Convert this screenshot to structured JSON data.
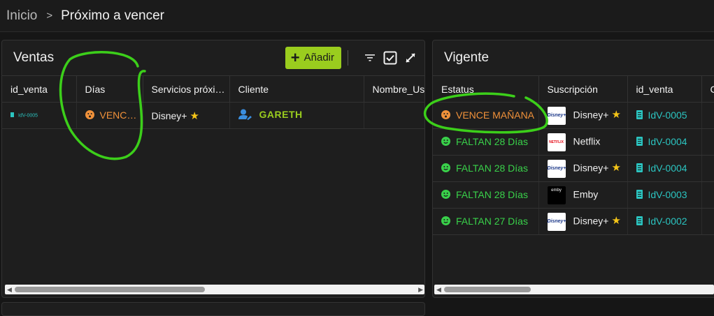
{
  "breadcrumb": {
    "home": "Inicio",
    "separator": ">",
    "current": "Próximo a vencer"
  },
  "ventas": {
    "title": "Ventas",
    "add_label": "Añadir",
    "columns": [
      "id_venta",
      "Días",
      "Servicios próxim...",
      "Cliente",
      "Nombre_Usu"
    ],
    "rows": [
      {
        "id_venta": "IdV-0005",
        "dias": "VENCE ...",
        "servicio": "Disney+",
        "cliente": "GARETH",
        "nombre": ""
      }
    ]
  },
  "vigente": {
    "title": "Vigente",
    "columns": [
      "Estatus",
      "Suscripción",
      "id_venta",
      "C"
    ],
    "rows": [
      {
        "estatus": "VENCE MAÑANA",
        "status_color": "#f0913a",
        "logo": "disney-logo",
        "logo_text": "Disney+",
        "suscripcion": "Disney+",
        "star": true,
        "id_venta": "IdV-0005"
      },
      {
        "estatus": "FALTAN 28 Días",
        "status_color": "#39d14a",
        "logo": "netflix-logo",
        "logo_text": "NETFLIX",
        "suscripcion": "Netflix",
        "star": false,
        "id_venta": "IdV-0004"
      },
      {
        "estatus": "FALTAN 28 Días",
        "status_color": "#39d14a",
        "logo": "disney-logo",
        "logo_text": "Disney+",
        "suscripcion": "Disney+",
        "star": true,
        "id_venta": "IdV-0004"
      },
      {
        "estatus": "FALTAN 28 Días",
        "status_color": "#39d14a",
        "logo": "emby-logo",
        "logo_text": "emby",
        "suscripcion": "Emby",
        "star": false,
        "id_venta": "IdV-0003"
      },
      {
        "estatus": "FALTAN 27 Días",
        "status_color": "#39d14a",
        "logo": "disney-logo",
        "logo_text": "Disney+",
        "suscripcion": "Disney+",
        "star": true,
        "id_venta": "IdV-0002"
      }
    ]
  },
  "colors": {
    "accent": "#9acd1e",
    "warning": "#f0913a",
    "ok": "#39d14a",
    "link": "#2bc4c0",
    "annotation": "#3ccf1a"
  }
}
